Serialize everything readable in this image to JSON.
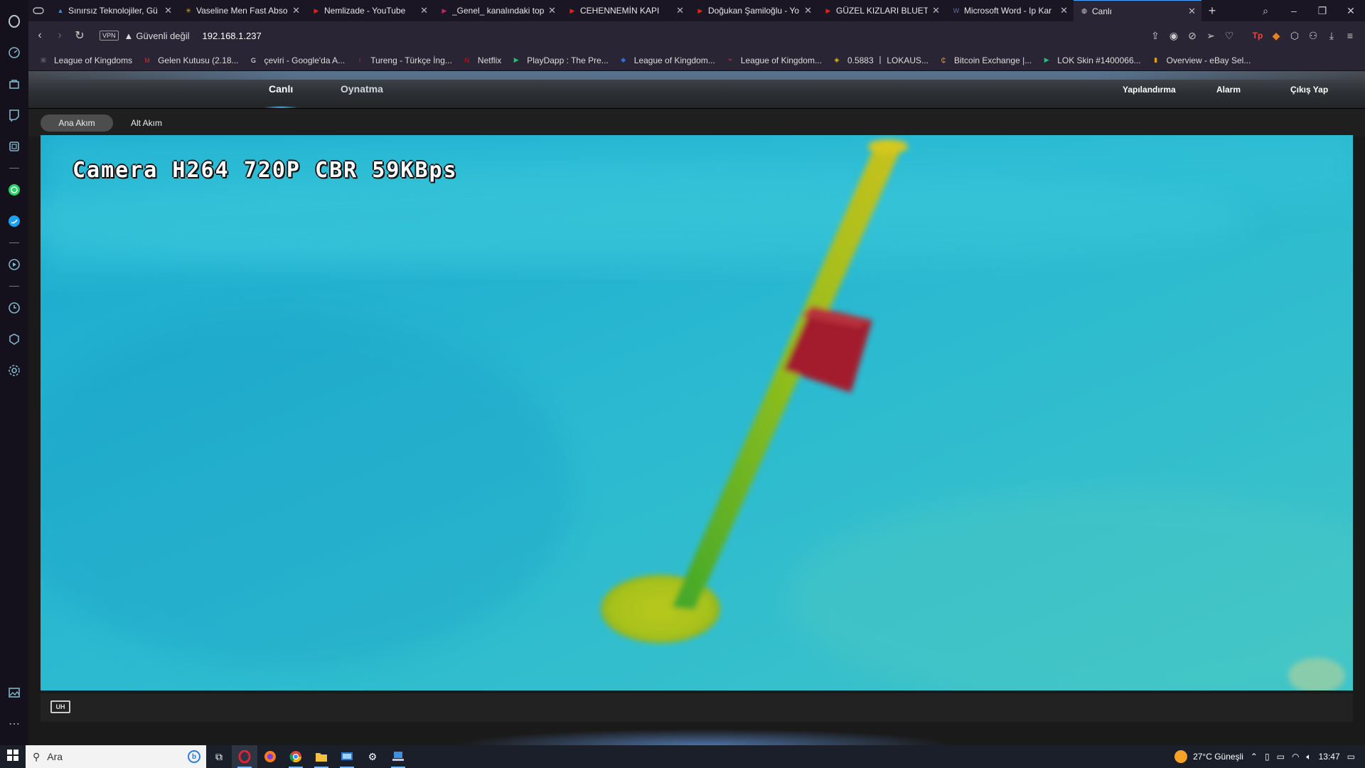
{
  "browser": {
    "tabs": [
      {
        "title": "Sınırsız Teknolojiler, Gü",
        "color": "#3a8ee6",
        "glyph": "▲"
      },
      {
        "title": "Vaseline Men Fast Abso",
        "color": "#e7b43a",
        "glyph": "✳"
      },
      {
        "title": "Nemlizade - YouTube",
        "color": "#e62117",
        "glyph": "▶"
      },
      {
        "title": "_Genel_ kanalındaki top",
        "color": "#c2265a",
        "glyph": "▶"
      },
      {
        "title": "CEHENNEMİN KAPI",
        "color": "#e62117",
        "glyph": "▶"
      },
      {
        "title": "Doğukan Şamiloğlu - Yo",
        "color": "#e62117",
        "glyph": "▶"
      },
      {
        "title": "GÜZEL KIZLARI BLUETO",
        "color": "#e62117",
        "glyph": "▶"
      },
      {
        "title": "Microsoft Word - Ip Kar",
        "color": "#5a6fb0",
        "glyph": "W"
      },
      {
        "title": "Canlı",
        "color": "#dddddd",
        "glyph": "◍"
      }
    ],
    "new_tab": "+",
    "address": {
      "vpn": "VPN",
      "security": "Güvenli değil",
      "url": "192.168.1.237"
    },
    "bookmarks": [
      {
        "label": "League of Kingdoms",
        "color": "#556",
        "glyph": "▣"
      },
      {
        "label": "Gelen Kutusu (2.18...",
        "color": "#c33",
        "glyph": "M"
      },
      {
        "label": "çeviri - Google'da A...",
        "color": "#fff",
        "glyph": "G"
      },
      {
        "label": "Tureng - Türkçe İng...",
        "color": "#b22",
        "glyph": "t"
      },
      {
        "label": "Netflix",
        "color": "#e50914",
        "glyph": "N"
      },
      {
        "label": "PlayDapp : The Pre...",
        "color": "#1dc17a",
        "glyph": "▶"
      },
      {
        "label": "League of Kingdom...",
        "color": "#2a6fdb",
        "glyph": "◆"
      },
      {
        "label": "League of Kingdom...",
        "color": "#7a3344",
        "glyph": "❧"
      },
      {
        "label": "0.5883 丨 LOKAUS...",
        "color": "#f0b90b",
        "glyph": "◈"
      },
      {
        "label": "Bitcoin Exchange |...",
        "color": "#f5a623",
        "glyph": "₵"
      },
      {
        "label": "LOK Skin #1400066...",
        "color": "#1dc17a",
        "glyph": "▶"
      },
      {
        "label": "Overview - eBay Sel...",
        "color": "#e0a400",
        "glyph": "▮"
      }
    ]
  },
  "camera_ui": {
    "nav": {
      "live": "Canlı",
      "playback": "Oynatma",
      "config": "Yapılandırma",
      "alarm": "Alarm",
      "logout": "Çıkış Yap"
    },
    "streams": {
      "main": "Ana Akım",
      "sub": "Alt Akım"
    },
    "osd_text": "Camera H264 720P CBR 59KBps",
    "control_icon": "UH"
  },
  "taskbar": {
    "search_placeholder": "Ara",
    "weather": "27°C  Güneşli",
    "time": "13:47"
  }
}
